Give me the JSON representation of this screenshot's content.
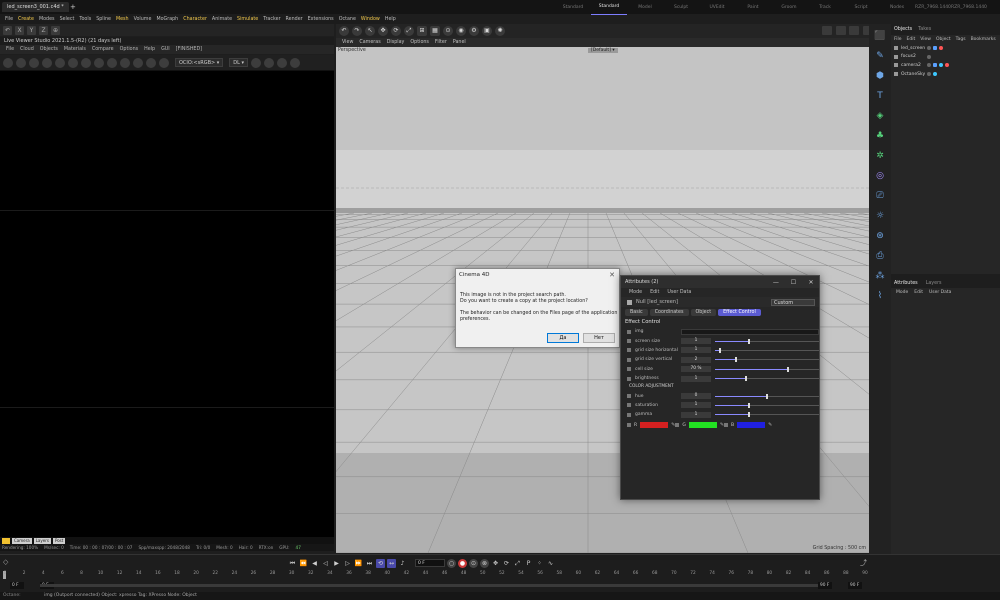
{
  "window": {
    "tab_title": "led_screen3_001.c4d *",
    "new_tab": "+",
    "layouts": [
      "Standard",
      "Standard",
      "Model",
      "Sculpt",
      "UVEdit",
      "Paint",
      "Groom",
      "Track",
      "Script",
      "Nodes",
      "RZR_7968.1440_layout.02",
      "RZR_7968.1440_arrows_layout"
    ],
    "active_layout_index": 1
  },
  "main_menu": [
    "File",
    "Create",
    "Modes",
    "Select",
    "Tools",
    "Spline",
    "Mesh",
    "Volume",
    "MoGraph",
    "Character",
    "Animate",
    "Simulate",
    "Tracker",
    "Render",
    "Extensions",
    "Octane",
    "Window",
    "Help"
  ],
  "main_menu_highlight": [
    "Create",
    "Mesh",
    "Character",
    "Simulate",
    "Window"
  ],
  "left_toolbar_icons": [
    "↶",
    "X",
    "Y",
    "Z",
    "⊕"
  ],
  "live_viewer": {
    "title": "Live Viewer Studio 2021.1.5-(R2) (21 days left)",
    "menu": [
      "File",
      "Cloud",
      "Objects",
      "Materials",
      "Compare",
      "Options",
      "Help",
      "GUI",
      "[FINISHED]"
    ],
    "colorspace": "OCIO:<sRGB> ▾",
    "display": "DL ▾",
    "status_tags": [
      "",
      "Camera",
      "Layers",
      "Post"
    ],
    "render_stats": [
      "Rendering: 100%",
      "Ms/sec: 0",
      "Time: 00 : 00 : 07/00 : 00 : 07",
      "Spp/maxspp: 2048/2048",
      "Tri: 0/0",
      "Mesh: 0",
      "Hair: 0",
      "RTX:on",
      "GPU:",
      "47"
    ]
  },
  "viewport": {
    "menu": [
      "View",
      "Cameras",
      "Display",
      "Options",
      "Filter",
      "Panel"
    ],
    "label": "Perspective",
    "camera": "[Default] ▾",
    "grid_spacing": "Grid Spacing : 500 cm"
  },
  "dialog": {
    "title": "Cinema 4D",
    "close": "✕",
    "line1": "This image is not in the project search path.",
    "line2": "Do you want to create a copy at the project location?",
    "line3": "The behavior can be changed on the Files page of the application preferences.",
    "yes_label": "Да",
    "no_label": "Нет"
  },
  "attributes_window": {
    "title": "Attributes (2)",
    "window_controls": [
      "—",
      "☐",
      "✕"
    ],
    "menu": [
      "Mode",
      "Edit",
      "User Data"
    ],
    "object_name": "Null [led_screen]",
    "preset": "Custom",
    "tabs": [
      "Basic",
      "Coordinates",
      "Object",
      "Effect Control"
    ],
    "active_tab_index": 3,
    "section": "Effect Control",
    "color_section": "COLOR ADJUSTMENT",
    "params": [
      {
        "label": "img",
        "value": "",
        "fill": 0
      },
      {
        "label": "screen size",
        "value": "1",
        "fill": 0.33
      },
      {
        "label": "grid size horizontal",
        "value": "1",
        "fill": 0.05
      },
      {
        "label": "grid size vertical",
        "value": "2",
        "fill": 0.2
      },
      {
        "label": "cell size",
        "value": "70 %",
        "fill": 0.7
      },
      {
        "label": "brightness",
        "value": "1",
        "fill": 0.3
      }
    ],
    "color_params": [
      {
        "label": "hue",
        "value": "0",
        "fill": 0.5
      },
      {
        "label": "saturation",
        "value": "1",
        "fill": 0.33
      },
      {
        "label": "gamma",
        "value": "1",
        "fill": 0.33
      }
    ],
    "rgb": [
      {
        "channel": "R",
        "color": "#d42020"
      },
      {
        "channel": "G",
        "color": "#22e022"
      },
      {
        "channel": "B",
        "color": "#2020e0"
      }
    ]
  },
  "objects_panel": {
    "tabs": [
      "Objects",
      "Takes"
    ],
    "menu": [
      "File",
      "Edit",
      "View",
      "Object",
      "Tags",
      "Bookmarks"
    ],
    "items": [
      "led_screen",
      "focus2",
      "camera2",
      "OctaneSky"
    ]
  },
  "attributes_panel": {
    "tabs": [
      "Attributes",
      "Layers"
    ],
    "menu": [
      "Mode",
      "Edit",
      "User Data"
    ]
  },
  "timeline": {
    "ticks": [
      "0",
      "2",
      "4",
      "6",
      "8",
      "10",
      "12",
      "14",
      "16",
      "18",
      "20",
      "22",
      "24",
      "26",
      "28",
      "30",
      "32",
      "34",
      "36",
      "38",
      "40",
      "42",
      "44",
      "46",
      "48",
      "50",
      "52",
      "54",
      "56",
      "58",
      "60",
      "62",
      "64",
      "66",
      "68",
      "70",
      "72",
      "74",
      "76",
      "78",
      "80",
      "82",
      "84",
      "86",
      "88",
      "90"
    ],
    "current_frame": "0 F",
    "start_frame": "0 F",
    "preview_start": "0 F",
    "preview_end": "90 F",
    "end_frame": "90 F"
  },
  "statusbar": {
    "mode": "Octane:",
    "message": "img (Outport connected) Object: xpresso Tag: XPresso Node: Object"
  }
}
